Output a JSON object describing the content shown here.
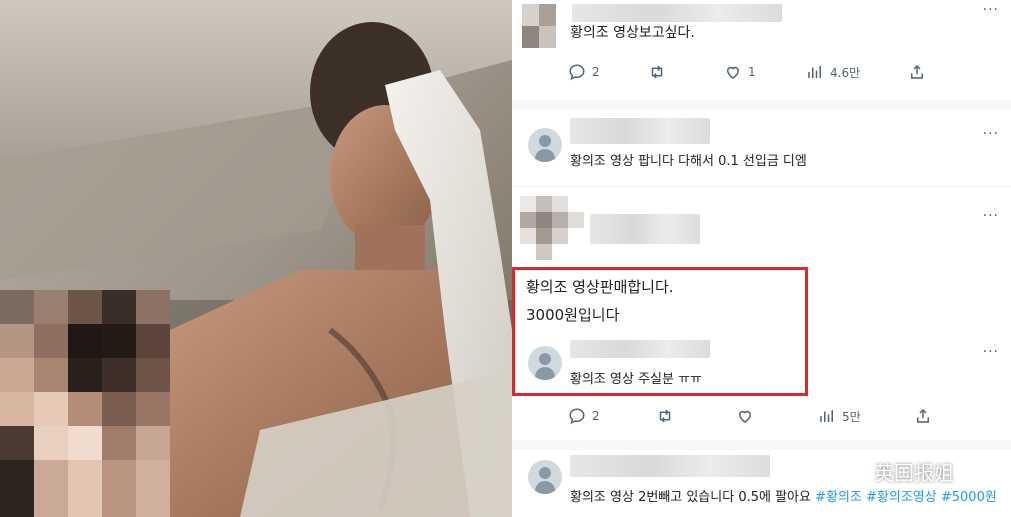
{
  "posts": [
    {
      "text": "황의조 영상보고싶다.",
      "actions": {
        "replies": "2",
        "likes": "1",
        "views": "4.6만"
      }
    },
    {
      "text": "황의조 영상 팝니다 다해서 0.1 선입금 디엠"
    },
    {
      "text_line1": "황의조 영상판매합니다.",
      "text_line2": "3000원입니다",
      "quoted_text": "황의조 영상 주실분 ㅠㅠ",
      "actions": {
        "replies": "2",
        "views": "5만"
      }
    },
    {
      "text_prefix": "황의조 영상 2번빼고 있습니다 0.5에 팔아요 ",
      "hashtags": [
        "#황의조",
        "#황의조영상",
        "#5000원"
      ]
    }
  ],
  "more_menu_glyph": "···",
  "watermark": {
    "text": "英国报姐",
    "icon": "wechat-icon"
  },
  "colors": {
    "highlight": "#e0262b",
    "hashtag": "#1d9bf0",
    "action_gray": "#536471"
  }
}
